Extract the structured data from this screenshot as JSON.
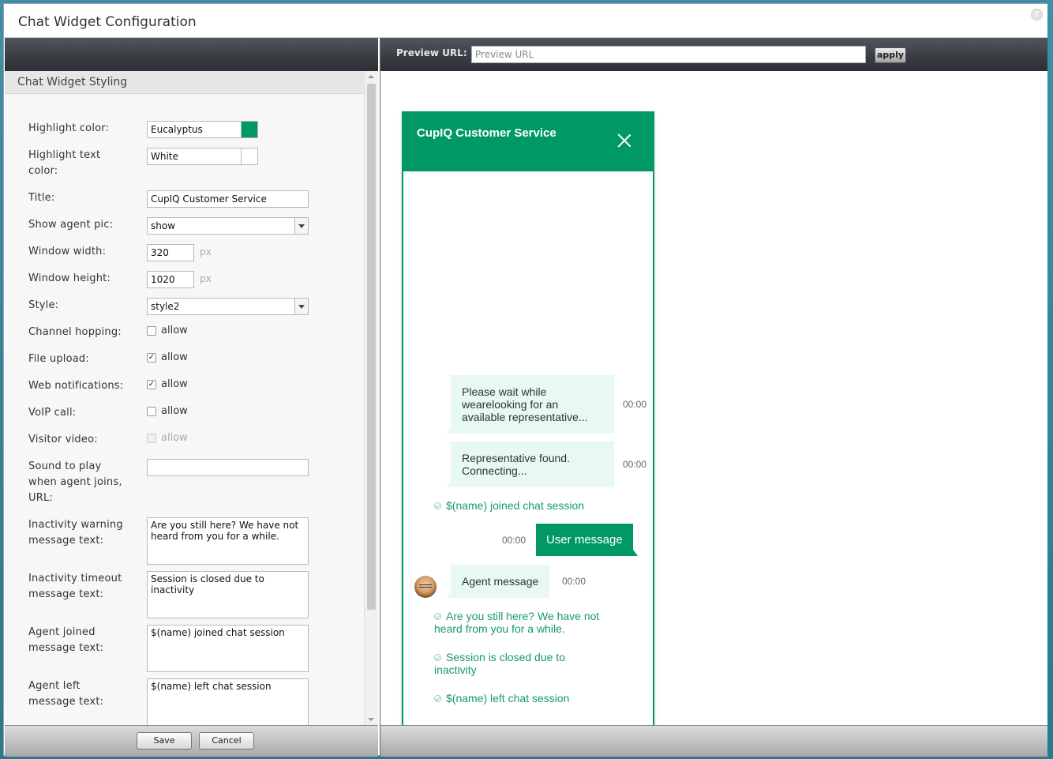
{
  "window": {
    "title": "Chat Widget Configuration",
    "help_glyph": "?"
  },
  "left": {
    "section_title": "Chat Widget Styling",
    "fields": {
      "highlight_color": {
        "label": "Highlight color:",
        "value": "Eucalyptus",
        "swatch": "#009966"
      },
      "highlight_text_color": {
        "label": "Highlight text color:",
        "value": "White",
        "swatch": "#ffffff"
      },
      "title": {
        "label": "Title:",
        "value": "CupIQ Customer Service"
      },
      "show_agent_pic": {
        "label": "Show agent pic:",
        "value": "show"
      },
      "window_width": {
        "label": "Window width:",
        "value": "320",
        "unit": "px"
      },
      "window_height": {
        "label": "Window height:",
        "value": "1020",
        "unit": "px"
      },
      "style": {
        "label": "Style:",
        "value": "style2"
      },
      "channel_hopping": {
        "label": "Channel hopping:",
        "option": "allow",
        "checked": false
      },
      "file_upload": {
        "label": "File upload:",
        "option": "allow",
        "checked": true
      },
      "web_notifications": {
        "label": "Web notifications:",
        "option": "allow",
        "checked": true
      },
      "voip_call": {
        "label": "VoIP call:",
        "option": "allow",
        "checked": false
      },
      "visitor_video": {
        "label": "Visitor video:",
        "option": "allow",
        "checked": false,
        "disabled": true
      },
      "sound_url": {
        "label": "Sound to play when agent joins, URL:",
        "value": ""
      },
      "inactivity_warning": {
        "label": "Inactivity warning message text:",
        "value": "Are you still here? We have not heard from you for a while."
      },
      "inactivity_timeout": {
        "label": "Inactivity timeout message text:",
        "value": "Session is closed due to inactivity"
      },
      "agent_joined": {
        "label": "Agent joined message text:",
        "value": "$(name) joined chat session"
      },
      "agent_left": {
        "label": "Agent left message text:",
        "value": "$(name) left chat session"
      }
    },
    "footer": {
      "save_label": "Save",
      "cancel_label": "Cancel"
    }
  },
  "right": {
    "preview_label": "Preview URL:",
    "preview_placeholder": "Preview URL",
    "apply_label": "apply",
    "widget": {
      "title": "CupIQ Customer Service",
      "messages": [
        {
          "type": "bot",
          "text": "Please wait while wearelooking for an available representative...",
          "time": "00:00"
        },
        {
          "type": "bot",
          "text": "Representative found. Connecting...",
          "time": "00:00"
        },
        {
          "type": "system",
          "text": "$(name) joined chat session"
        },
        {
          "type": "user",
          "text": "User message",
          "time": "00:00"
        },
        {
          "type": "agent",
          "text": "Agent message",
          "time": "00:00"
        },
        {
          "type": "system",
          "text": "Are you still here? We have not heard from you for a while."
        },
        {
          "type": "system",
          "text": "Session is closed due to inactivity"
        },
        {
          "type": "system",
          "text": "$(name) left chat session"
        }
      ]
    }
  },
  "colors": {
    "accent": "#009966",
    "bubble_bg": "#e8f8f2",
    "toolbar_dark": "#383d42"
  }
}
